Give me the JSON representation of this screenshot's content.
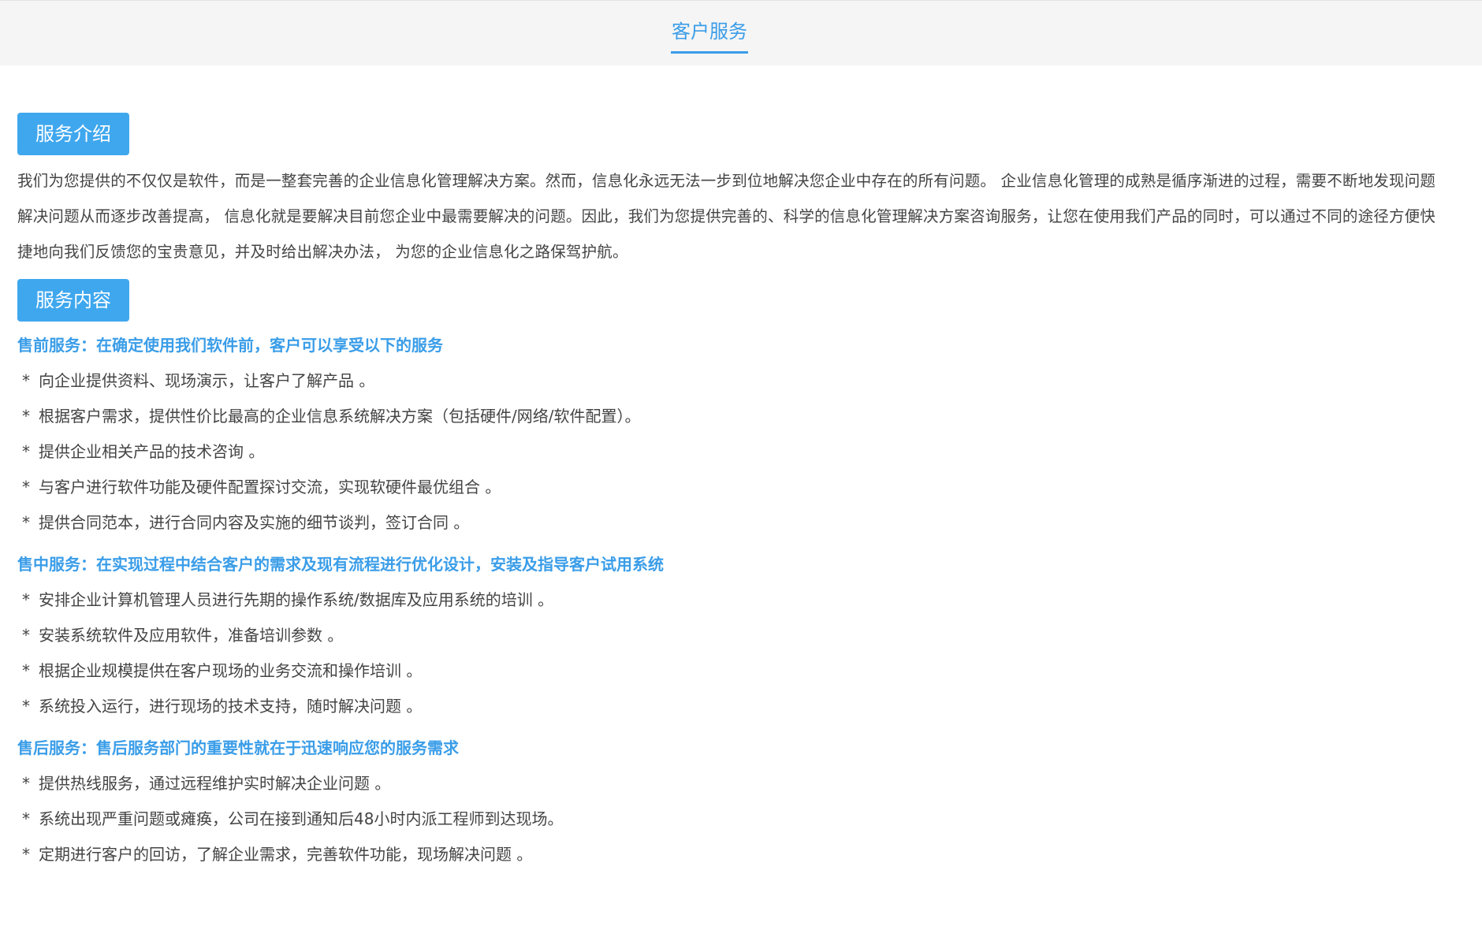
{
  "header": {
    "tab_label": "客户服务"
  },
  "intro": {
    "title": "服务介绍",
    "text": "我们为您提供的不仅仅是软件，而是一整套完善的企业信息化管理解决方案。然而，信息化永远无法一步到位地解决您企业中存在的所有问题。 企业信息化管理的成熟是循序渐进的过程，需要不断地发现问题解决问题从而逐步改善提高， 信息化就是要解决目前您企业中最需要解决的问题。因此，我们为您提供完善的、科学的信息化管理解决方案咨询服务，让您在使用我们产品的同时，可以通过不同的途径方便快捷地向我们反馈您的宝贵意见，并及时给出解决办法， 为您的企业信息化之路保驾护航。"
  },
  "content": {
    "title": "服务内容",
    "bullet": "*",
    "groups": [
      {
        "heading": "售前服务：在确定使用我们软件前，客户可以享受以下的服务",
        "items": [
          "向企业提供资料、现场演示，让客户了解产品 。",
          "根据客户需求，提供性价比最高的企业信息系统解决方案（包括硬件/网络/软件配置）。",
          "提供企业相关产品的技术咨询 。",
          "与客户进行软件功能及硬件配置探讨交流，实现软硬件最优组合 。",
          "提供合同范本，进行合同内容及实施的细节谈判，签订合同 。"
        ]
      },
      {
        "heading": "售中服务：在实现过程中结合客户的需求及现有流程进行优化设计，安装及指导客户试用系统",
        "items": [
          "安排企业计算机管理人员进行先期的操作系统/数据库及应用系统的培训 。",
          "安装系统软件及应用软件，准备培训参数 。",
          "根据企业规模提供在客户现场的业务交流和操作培训 。",
          "系统投入运行，进行现场的技术支持，随时解决问题 。"
        ]
      },
      {
        "heading": "售后服务：售后服务部门的重要性就在于迅速响应您的服务需求",
        "items": [
          "提供热线服务，通过远程维护实时解决企业问题 。",
          "系统出现严重问题或瘫痪，公司在接到通知后48小时内派工程师到达现场。",
          "定期进行客户的回访，了解企业需求，完善软件功能，现场解决问题 。"
        ]
      }
    ]
  },
  "colors": {
    "accent": "#3a9de8",
    "section_title_bg": "#3fa7ee",
    "topbar_bg": "#f5f5f5",
    "text": "#444444"
  }
}
